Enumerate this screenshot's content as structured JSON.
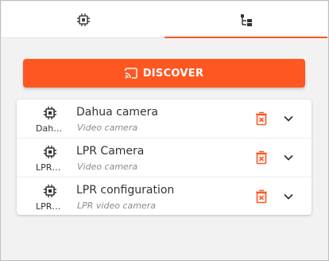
{
  "tabs": [
    {
      "icon": "chip-icon",
      "active": false
    },
    {
      "icon": "tree-icon",
      "active": true
    }
  ],
  "discover": {
    "label": "DISCOVER",
    "icon": "cast-icon"
  },
  "colors": {
    "accent": "#ff5722",
    "text": "#333333",
    "muted": "#8a8a8a"
  },
  "devices": [
    {
      "short": "Dahua camera",
      "name": "Dahua camera",
      "type": "Video camera"
    },
    {
      "short": "LPR Camera",
      "name": "LPR Camera",
      "type": "Video camera"
    },
    {
      "short": "LPR configuration",
      "name": "LPR configuration",
      "type": "LPR video camera"
    }
  ]
}
